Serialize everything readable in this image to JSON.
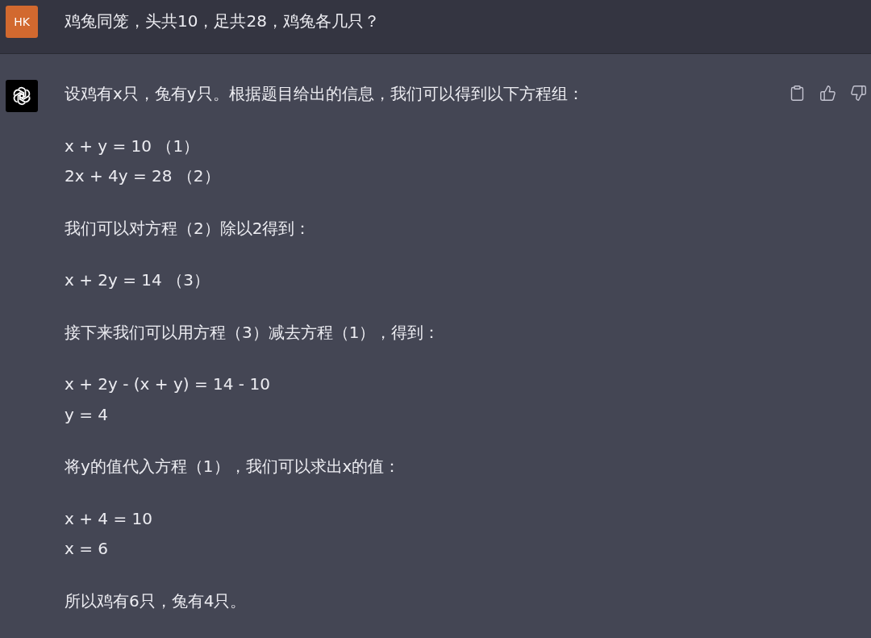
{
  "user_message": {
    "avatar": "HK",
    "text": "鸡兔同笼，头共10，足共28，鸡兔各几只？"
  },
  "assistant_message": {
    "paragraphs": [
      {
        "lines": [
          "设鸡有x只，兔有y只。根据题目给出的信息，我们可以得到以下方程组："
        ]
      },
      {
        "lines": [
          "x + y = 10 （1）",
          "2x + 4y = 28 （2）"
        ]
      },
      {
        "lines": [
          "我们可以对方程（2）除以2得到："
        ]
      },
      {
        "lines": [
          "x + 2y = 14 （3）"
        ]
      },
      {
        "lines": [
          "接下来我们可以用方程（3）减去方程（1），得到："
        ]
      },
      {
        "lines": [
          "x + 2y - (x + y) = 14 - 10",
          "y = 4"
        ]
      },
      {
        "lines": [
          "将y的值代入方程（1），我们可以求出x的值："
        ]
      },
      {
        "lines": [
          "x + 4 = 10",
          "x = 6"
        ]
      },
      {
        "lines": [
          "所以鸡有6只，兔有4只。"
        ]
      }
    ]
  }
}
